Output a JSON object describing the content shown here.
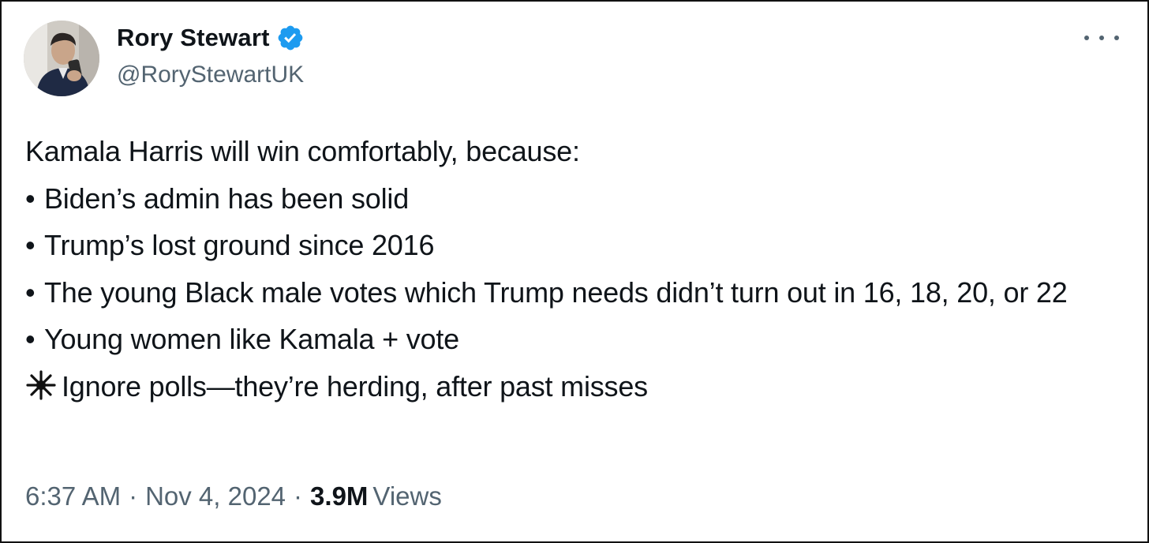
{
  "author": {
    "display_name": "Rory Stewart",
    "handle": "@RoryStewartUK",
    "verified": true,
    "verified_icon": "verified-badge-icon",
    "verified_color": "#1d9bf0"
  },
  "tweet": {
    "intro": "Kamala Harris will win comfortably, because:",
    "bullet_symbol": "•",
    "bullets": [
      "Biden’s admin has been solid",
      "Trump’s lost ground since 2016",
      "The young Black male votes which Trump needs didn’t turn out in 16, 18, 20, or 22",
      "Young women like Kamala + vote"
    ],
    "highlight_icon": "sparkle-icon",
    "highlight": "Ignore polls—they’re herding, after past misses"
  },
  "meta": {
    "time": "6:37 AM",
    "separator": "·",
    "date": "Nov 4, 2024",
    "views_count": "3.9M",
    "views_label": "Views"
  },
  "colors": {
    "text_primary": "#0f1419",
    "text_secondary": "#536471",
    "accent": "#1d9bf0"
  }
}
